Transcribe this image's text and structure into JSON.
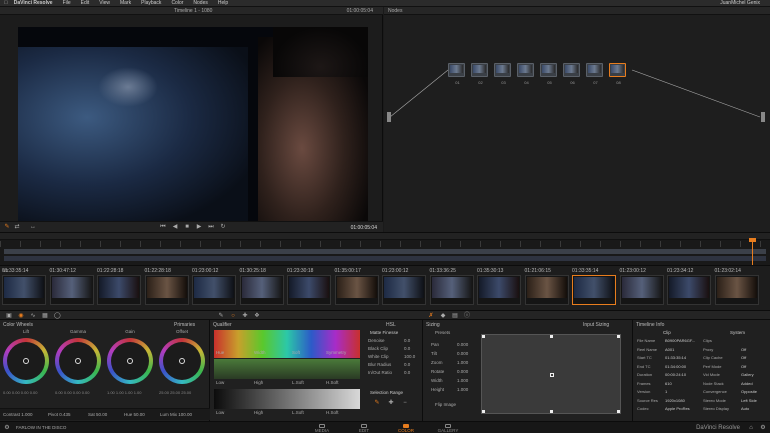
{
  "menubar": {
    "app": "DaVinci Resolve",
    "items": [
      "File",
      "Edit",
      "View",
      "Mark",
      "Playback",
      "Color",
      "Nodes",
      "Help"
    ],
    "right": "JuanMichel Genix"
  },
  "viewer": {
    "title": "Timeline 1 - 1080",
    "timecode_top": "01:00:05:04",
    "timecode_bottom": "01:00:05:04"
  },
  "nodes": {
    "title": "Nodes",
    "labels": [
      "01",
      "02",
      "03",
      "04",
      "05",
      "06",
      "07",
      "08"
    ]
  },
  "clips": {
    "timecodes": [
      "01:33:35:14",
      "01:30:47:12",
      "01:22:28:18",
      "01:22:28:18",
      "01:23:00:12",
      "01:30:25:18",
      "01:23:30:18",
      "01:35:00:17",
      "01:23:00:12",
      "01:33:36:25",
      "01:35:30:13",
      "01:21:06:15",
      "01:33:35:14",
      "01:23:00:12",
      "01:23:34:12",
      "01:23:02:14"
    ],
    "selected_index": 12,
    "left_label": "V1"
  },
  "color_wheels": {
    "title": "Color Wheels",
    "primaries": "Primaries",
    "wheels": [
      {
        "label": "Lift",
        "vals": "0.00  0.00  0.00  0.00"
      },
      {
        "label": "Gamma",
        "vals": "0.00  0.00  0.00  0.00"
      },
      {
        "label": "Gain",
        "vals": "1.00  1.00  1.00  1.00"
      },
      {
        "label": "Offset",
        "vals": "25.00  25.00  25.00"
      }
    ],
    "footer": [
      "Contrast 1.000",
      "Pivot 0.435",
      "Sat 50.00",
      "Hue 50.00",
      "Lum Mix 100.00"
    ]
  },
  "qualifier": {
    "title": "Qualifier",
    "row1": [
      "Hue",
      "Width",
      "Soft",
      "Symmetry"
    ],
    "row2": [
      "Low",
      "High",
      "L.Soft",
      "H.Soft"
    ],
    "row3": [
      "Low",
      "High",
      "L.Soft",
      "H.Soft"
    ],
    "hsl_title": "HSL",
    "matte_finesse": "Matte Finesse",
    "finesse": [
      {
        "k": "Denoise",
        "v": "0.0"
      },
      {
        "k": "Black Clip",
        "v": "0.0"
      },
      {
        "k": "White Clip",
        "v": "100.0"
      },
      {
        "k": "Blur Radius",
        "v": "0.0"
      },
      {
        "k": "In/Out Ratio",
        "v": "0.0"
      }
    ],
    "selection_range": "Selection Range"
  },
  "sizing": {
    "title": "Sizing",
    "input_sizing": "Input Sizing",
    "preset_label": "Presets",
    "rows": [
      {
        "k": "Pan",
        "v": "0.000"
      },
      {
        "k": "Tilt",
        "v": "0.000"
      },
      {
        "k": "Zoom",
        "v": "1.000"
      },
      {
        "k": "Rotate",
        "v": "0.000"
      },
      {
        "k": "Width",
        "v": "1.000"
      },
      {
        "k": "Height",
        "v": "1.000"
      }
    ],
    "flip": "Flip Image"
  },
  "timeline_info": {
    "title": "Timeline Info",
    "clip_header": "Clip",
    "system_header": "System",
    "clip_rows": [
      {
        "k": "File Name",
        "v": "B0900PAR6GF..."
      },
      {
        "k": "Reel Name",
        "v": "A001"
      },
      {
        "k": "Start TC",
        "v": "01:33:35:14"
      },
      {
        "k": "End TC",
        "v": "01:34:00:00"
      },
      {
        "k": "Duration",
        "v": "00:00:24:10"
      },
      {
        "k": "Frames",
        "v": "610"
      },
      {
        "k": "Version",
        "v": "1"
      },
      {
        "k": "Source Res",
        "v": "1920x1080"
      },
      {
        "k": "Codec",
        "v": "Apple ProRes"
      }
    ],
    "system_rows": [
      {
        "k": "Clips",
        "v": ""
      },
      {
        "k": "Proxy",
        "v": "Off"
      },
      {
        "k": "Clip Cache",
        "v": "Off"
      },
      {
        "k": "Perf Mode",
        "v": "Off"
      },
      {
        "k": "Vid Mode",
        "v": "Gallery"
      },
      {
        "k": "Node Stack",
        "v": "Added"
      },
      {
        "k": "Convergence",
        "v": "Opposite"
      },
      {
        "k": "Stereo Mode",
        "v": "Left Side"
      },
      {
        "k": "Stereo Display",
        "v": "Auto"
      }
    ]
  },
  "statusbar": {
    "project": "FARLOW IN THE DISCO",
    "tabs": [
      "MEDIA",
      "EDIT",
      "COLOR",
      "GALLERY"
    ],
    "active_tab": 2,
    "brand": "DaVinci Resolve"
  },
  "colors": {
    "accent": "#e87d1e",
    "panel": "#202020",
    "border": "#0c0c0c"
  }
}
